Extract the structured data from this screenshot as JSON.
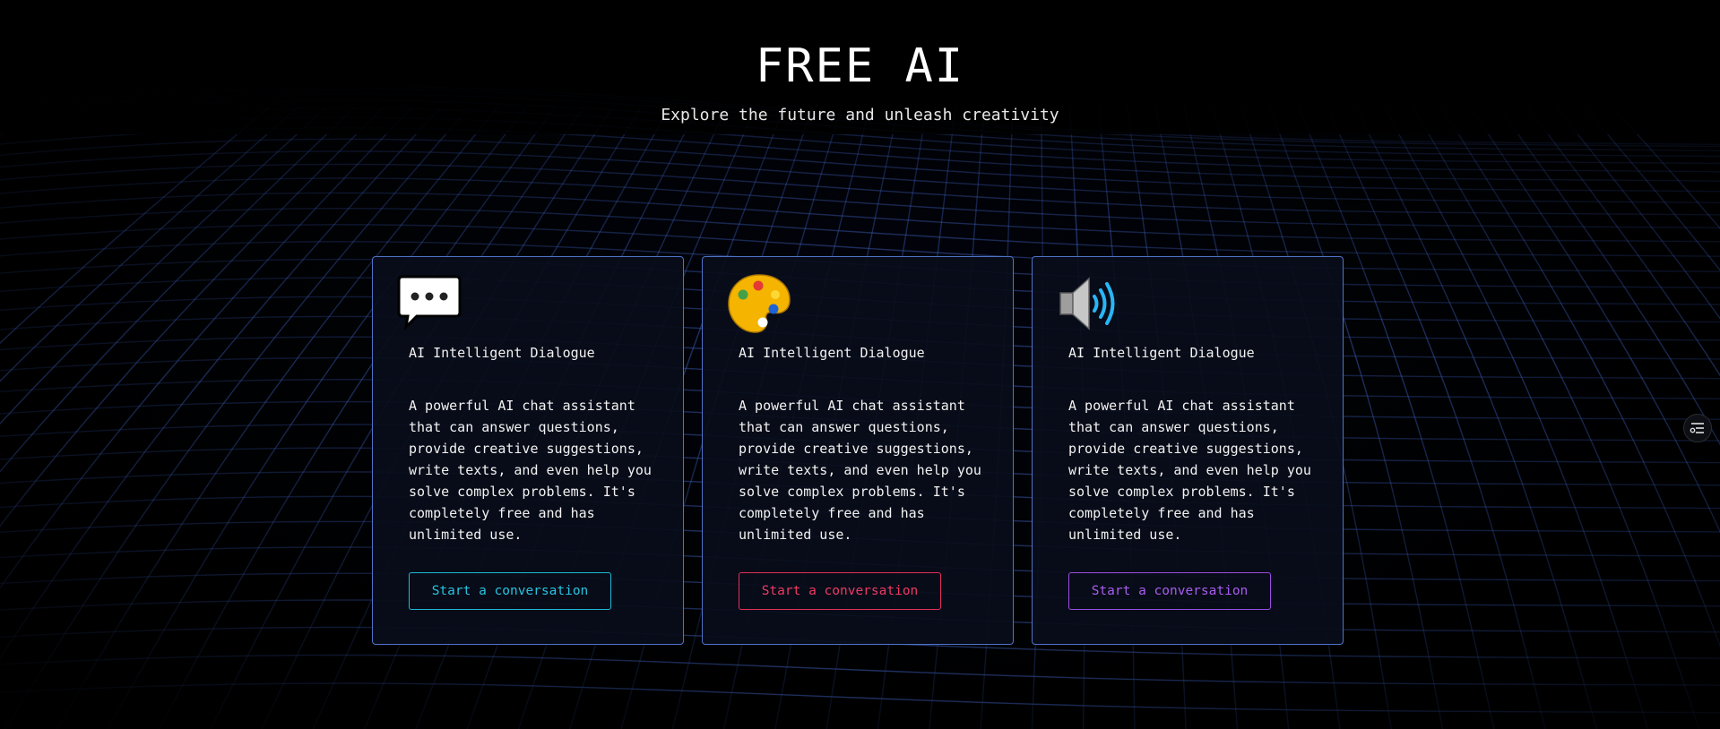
{
  "hero": {
    "title": "FREE AI",
    "subtitle": "Explore the future and unleash creativity"
  },
  "cards": [
    {
      "icon": "speech-bubble-icon",
      "title": "AI Intelligent Dialogue",
      "description": "A powerful AI chat assistant that can answer questions, provide creative suggestions, write texts, and even help you solve complex problems. It's completely free and has unlimited use.",
      "button_label": "Start a conversation",
      "accent": "#27c3e0"
    },
    {
      "icon": "palette-icon",
      "title": "AI Intelligent Dialogue",
      "description": "A powerful AI chat assistant that can answer questions, provide creative suggestions, write texts, and even help you solve complex problems. It's completely free and has unlimited use.",
      "button_label": "Start a conversation",
      "accent": "#ee3a62"
    },
    {
      "icon": "speaker-icon",
      "title": "AI Intelligent Dialogue",
      "description": "A powerful AI chat assistant that can answer questions, provide creative suggestions, write texts, and even help you solve complex problems. It's completely free and has unlimited use.",
      "button_label": "Start a conversation",
      "accent": "#a95cf0"
    }
  ],
  "side_widget": {
    "icon": "settings-list-icon"
  },
  "colors": {
    "background": "#000000",
    "card_border": "#4f72c8",
    "grid_line": "#3c64d2"
  }
}
